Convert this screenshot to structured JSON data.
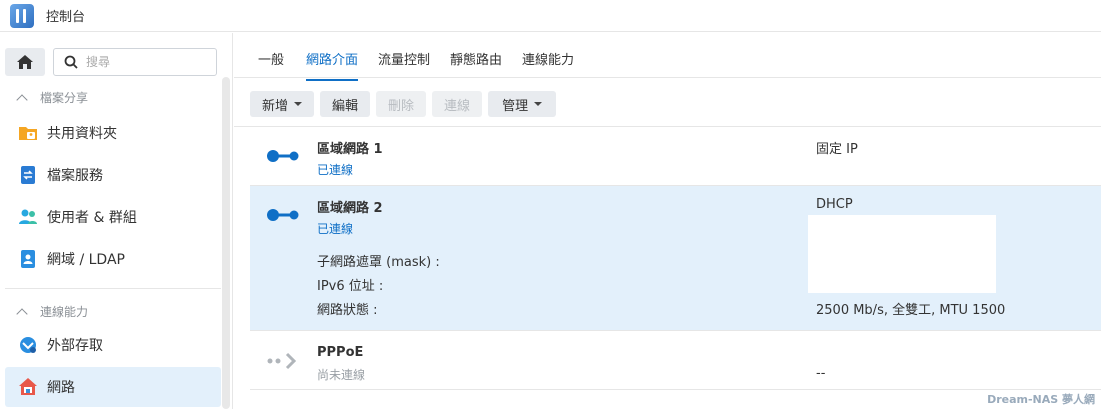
{
  "window": {
    "title": "控制台",
    "icon": "control-panel-icon"
  },
  "sidebar": {
    "search_placeholder": "搜尋",
    "sections": [
      {
        "label": "檔案分享"
      },
      {
        "label": "連線能力"
      }
    ],
    "items": [
      {
        "label": "共用資料夾",
        "icon": "shared-folder-icon"
      },
      {
        "label": "檔案服務",
        "icon": "file-services-icon"
      },
      {
        "label": "使用者 & 群組",
        "icon": "users-groups-icon"
      },
      {
        "label": "網域 / LDAP",
        "icon": "domain-ldap-icon"
      },
      {
        "label": "外部存取",
        "icon": "external-access-icon"
      },
      {
        "label": "網路",
        "icon": "network-house-icon",
        "active": true
      }
    ]
  },
  "tabs": [
    {
      "label": "一般"
    },
    {
      "label": "網路介面",
      "active": true
    },
    {
      "label": "流量控制"
    },
    {
      "label": "靜態路由"
    },
    {
      "label": "連線能力"
    }
  ],
  "toolbar": {
    "create": "新增",
    "edit": "編輯",
    "delete": "刪除",
    "connect": "連線",
    "manage": "管理"
  },
  "interfaces": [
    {
      "name": "區域網路 1",
      "status": "已連線",
      "type": "固定 IP"
    },
    {
      "name": "區域網路 2",
      "status": "已連線",
      "type": "DHCP",
      "details": [
        {
          "label": "子網路遮罩 (mask) :"
        },
        {
          "label": "IPv6 位址 :"
        },
        {
          "label": "網路狀態 :",
          "value": "2500 Mb/s, 全雙工, MTU 1500"
        }
      ]
    },
    {
      "name": "PPPoE",
      "status": "尚未連線",
      "type": "--"
    }
  ],
  "watermark": "Dream-NAS 夢人網",
  "colors": {
    "accent": "#0f6fc6",
    "selected_bg": "#e3f0fb"
  }
}
